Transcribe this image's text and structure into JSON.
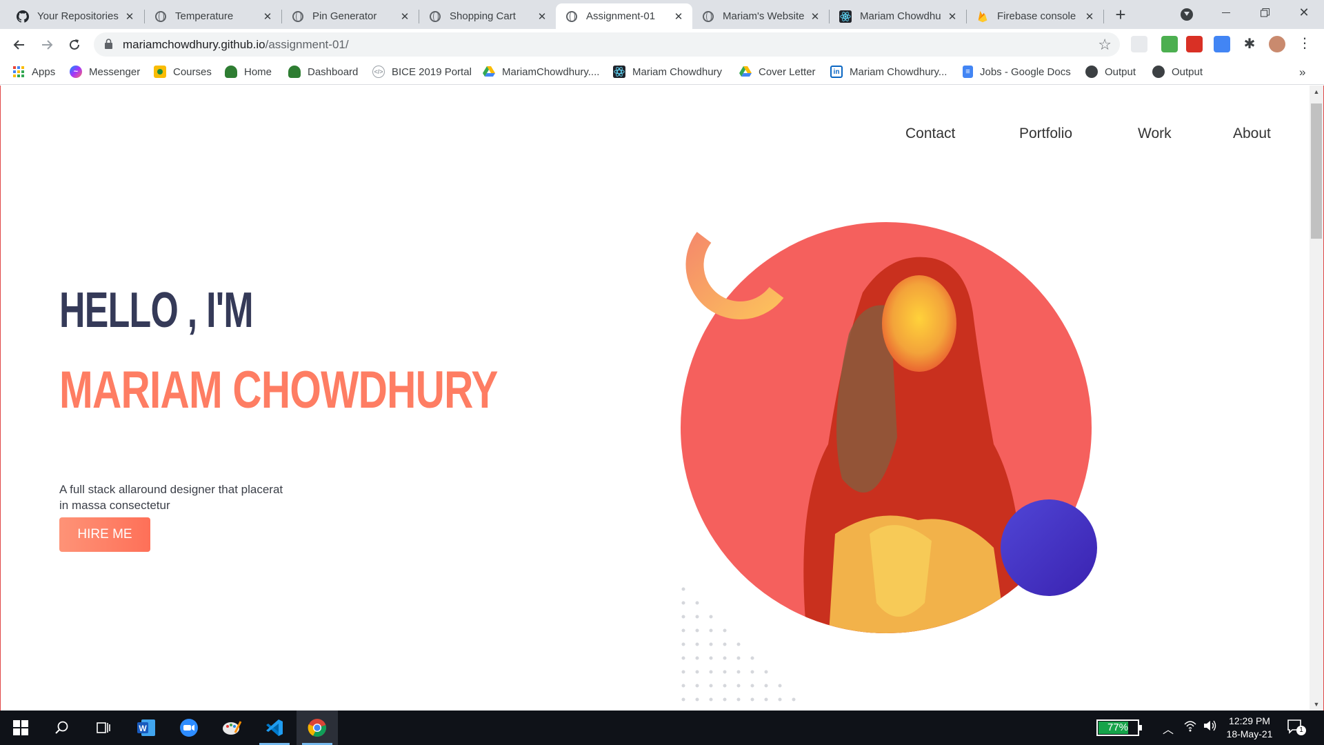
{
  "browser": {
    "tabs": [
      {
        "label": "Your Repositories",
        "icon": "github-icon",
        "active": false
      },
      {
        "label": "Temperature",
        "icon": "globe-icon",
        "active": false
      },
      {
        "label": "Pin Generator",
        "icon": "globe-icon",
        "active": false
      },
      {
        "label": "Shopping Cart",
        "icon": "globe-icon",
        "active": false
      },
      {
        "label": "Assignment-01",
        "icon": "globe-icon",
        "active": true
      },
      {
        "label": "Mariam's Website",
        "icon": "globe-icon",
        "active": false
      },
      {
        "label": "Mariam Chowdhu",
        "icon": "react-icon",
        "active": false
      },
      {
        "label": "Firebase console",
        "icon": "firebase-icon",
        "active": false
      }
    ],
    "close_glyph": "✕",
    "new_tab_glyph": "+",
    "url_host": "mariamchowdhury.github.io",
    "url_path": "/assignment-01/",
    "bookmarks": [
      {
        "label": "Apps",
        "icon": "apps-grid-icon"
      },
      {
        "label": "Messenger",
        "icon": "messenger-icon"
      },
      {
        "label": "Courses",
        "icon": "classroom-icon"
      },
      {
        "label": "Home",
        "icon": "school-logo-icon"
      },
      {
        "label": "Dashboard",
        "icon": "school-logo-icon"
      },
      {
        "label": "BICE 2019 Portal",
        "icon": "code-icon"
      },
      {
        "label": "MariamChowdhury....",
        "icon": "google-drive-icon"
      },
      {
        "label": "Mariam Chowdhury",
        "icon": "react-icon"
      },
      {
        "label": "Cover Letter",
        "icon": "google-drive-icon"
      },
      {
        "label": "Mariam Chowdhury...",
        "icon": "linkedin-icon"
      },
      {
        "label": "Jobs - Google Docs",
        "icon": "google-docs-icon"
      },
      {
        "label": "Output",
        "icon": "globe-icon"
      },
      {
        "label": "Output",
        "icon": "globe-icon"
      }
    ],
    "more_bookmarks": "»"
  },
  "site": {
    "nav": [
      "Contact",
      "Portfolio",
      "Work",
      "About"
    ],
    "hero_greeting": "HELLO , I'M",
    "hero_name": "MARIAM CHOWDHURY",
    "description_line1": "A full stack allaround designer that placerat",
    "description_line2": "in massa consectetur",
    "hire_label": "HIRE ME",
    "colors": {
      "accent": "#fe7d63",
      "navy": "#353a58",
      "circle": "#f5605d",
      "purple": "#4a35c8",
      "arc": "#fcae5e"
    }
  },
  "taskbar": {
    "apps": [
      "windows-start-icon",
      "search-icon",
      "task-view-icon",
      "word-icon",
      "zoom-icon",
      "paint-icon",
      "vscode-icon",
      "chrome-icon"
    ],
    "battery": "77%",
    "time": "12:29 PM",
    "date": "18-May-21",
    "notifications": "1"
  }
}
